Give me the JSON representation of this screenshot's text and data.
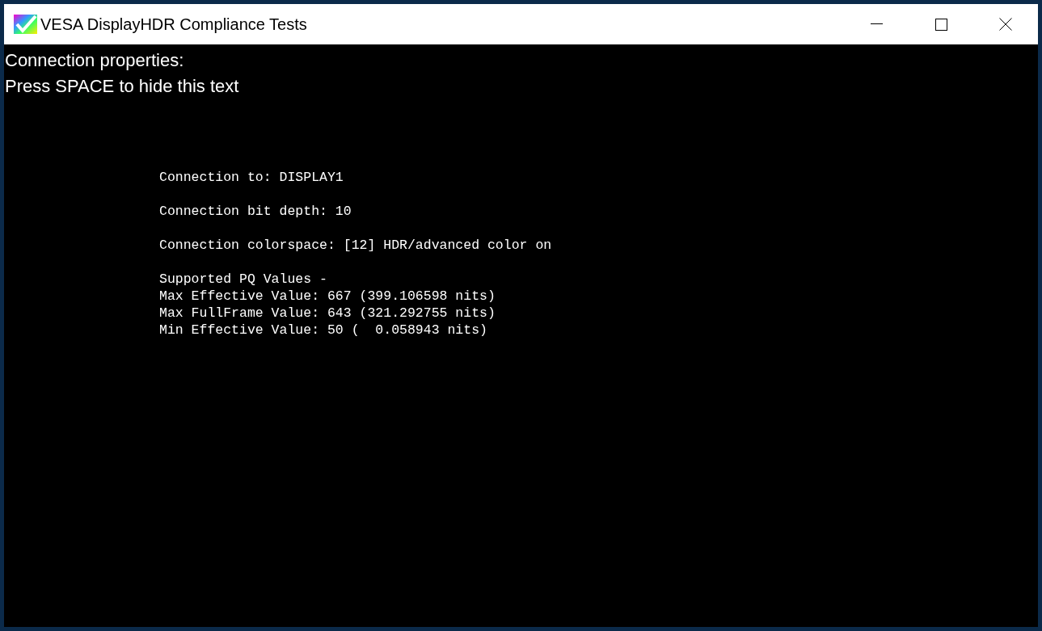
{
  "window": {
    "title": "VESA DisplayHDR Compliance Tests"
  },
  "overlay_text": [
    "Connection properties:",
    "Press SPACE to hide this text"
  ],
  "info_blocks": [
    [
      "Connection to: DISPLAY1"
    ],
    [
      "Connection bit depth: 10"
    ],
    [
      "Connection colorspace: [12] HDR/advanced color on"
    ],
    [
      "Supported PQ Values -",
      "Max Effective Value: 667 (399.106598 nits)",
      "Max FullFrame Value: 643 (321.292755 nits)",
      "Min Effective Value: 50 (  0.058943 nits)"
    ]
  ]
}
